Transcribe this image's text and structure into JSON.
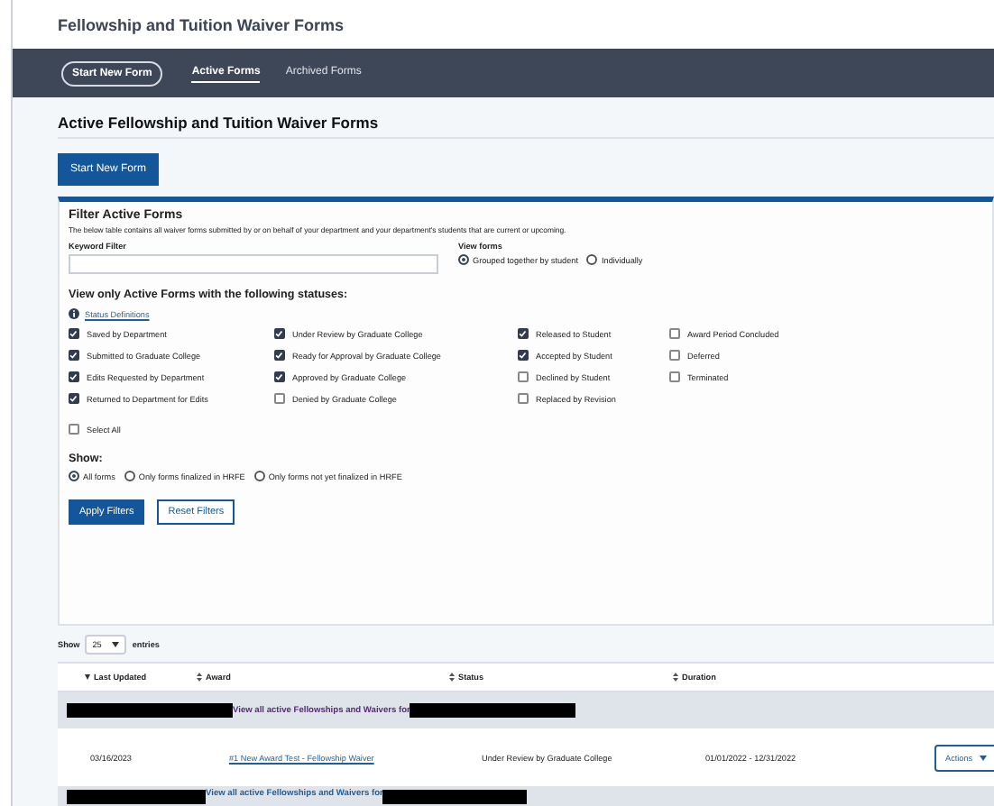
{
  "page_title": "Fellowship and Tuition Waiver Forms",
  "nav": [
    {
      "label": "Start New Form",
      "kind": "button"
    },
    {
      "label": "Active Forms",
      "kind": "tab",
      "selected": true
    },
    {
      "label": "Archived Forms",
      "kind": "tab",
      "selected": false
    }
  ],
  "heading": "Active Fellowship and Tuition Waiver Forms",
  "start_button": "Start New Form",
  "filter": {
    "title": "Filter Active Forms",
    "description": "The below table contains all waiver forms submitted by or on behalf of your department and your department's students that are current or upcoming.",
    "keyword_label": "Keyword Filter",
    "view_label": "View forms",
    "view_options": [
      {
        "label": "Grouped together by student",
        "selected": true
      },
      {
        "label": "Individually",
        "selected": false
      }
    ],
    "statuses_heading": "View only Active Forms with the following statuses:",
    "definitions_link": "Status Definitions",
    "statuses": [
      {
        "label": "Saved by Department",
        "checked": true
      },
      {
        "label": "Under Review by Graduate College",
        "checked": true
      },
      {
        "label": "Released to Student",
        "checked": true
      },
      {
        "label": "Award Period Concluded",
        "checked": false
      },
      {
        "label": "Submitted to Graduate College",
        "checked": true
      },
      {
        "label": "Ready for Approval by Graduate College",
        "checked": true
      },
      {
        "label": "Accepted by Student",
        "checked": true
      },
      {
        "label": "Deferred",
        "checked": false
      },
      {
        "label": "Edits Requested by Department",
        "checked": true
      },
      {
        "label": "Approved by Graduate College",
        "checked": true
      },
      {
        "label": "Declined by Student",
        "checked": false
      },
      {
        "label": "Terminated",
        "checked": false
      },
      {
        "label": "Returned to Department for Edits",
        "checked": true
      },
      {
        "label": "Denied by Graduate College",
        "checked": false
      },
      {
        "label": "Replaced by Revision",
        "checked": false
      }
    ],
    "select_all": {
      "label": "Select All",
      "checked": false
    },
    "show_label": "Show:",
    "show_options": [
      {
        "label": "All forms",
        "selected": true
      },
      {
        "label": "Only forms finalized in HRFE",
        "selected": false
      },
      {
        "label": "Only forms not yet finalized in HRFE",
        "selected": false
      }
    ],
    "apply_button": "Apply Filters",
    "reset_button": "Reset Filters"
  },
  "entries": {
    "before": "Show",
    "value": "25",
    "after": "entries"
  },
  "table": {
    "columns": [
      {
        "label": "Last Updated",
        "sorted": true
      },
      {
        "label": "Award",
        "sorted": false
      },
      {
        "label": "Status",
        "sorted": false
      },
      {
        "label": "Duration",
        "sorted": false
      }
    ],
    "rows": [
      {
        "kind": "group",
        "link": "View all active Fellowships and Waivers for"
      },
      {
        "kind": "form",
        "last_updated": "03/16/2023",
        "award": "#1 New Award Test - Fellowship Waiver",
        "status": "Under Review by Graduate College",
        "duration": "01/01/2022 - 12/31/2022",
        "action": "Actions"
      },
      {
        "kind": "group",
        "link": "View all active Fellowships and Waivers for"
      }
    ]
  }
}
